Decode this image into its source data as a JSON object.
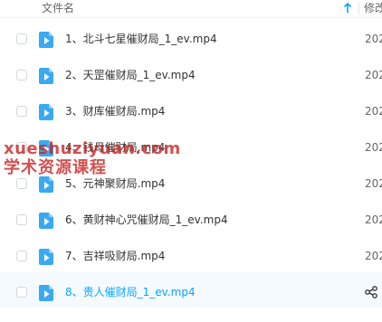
{
  "header": {
    "col_name": "文件名",
    "col_modified": "修改"
  },
  "files": [
    {
      "name": "1、北斗七星催财局_1_ev.mp4",
      "date": "202",
      "hover": false
    },
    {
      "name": "2、天罡催财局_1_ev.mp4",
      "date": "202",
      "hover": false
    },
    {
      "name": "3、财库催财局.mp4",
      "date": "202",
      "hover": false
    },
    {
      "name": "4、钱母催财局.mp4",
      "date": "202",
      "hover": false
    },
    {
      "name": "5、元神聚财局.mp4",
      "date": "202",
      "hover": false
    },
    {
      "name": "6、黄财神心咒催财局_1_ev.mp4",
      "date": "202",
      "hover": false
    },
    {
      "name": "7、吉祥吸财局.mp4",
      "date": "202",
      "hover": false
    },
    {
      "name": "8、贵人催财局_1_ev.mp4",
      "date": "",
      "hover": true
    }
  ],
  "watermark": {
    "line1": "xueshuziyuan.com",
    "line2": "学术资源课程"
  },
  "colors": {
    "accent": "#06a7ff",
    "file_icon": "#3aa9f0",
    "watermark": "#c81e1e"
  },
  "icons": {
    "sort": "arrow-up-icon",
    "file": "video-file-icon",
    "share": "share-icon"
  }
}
